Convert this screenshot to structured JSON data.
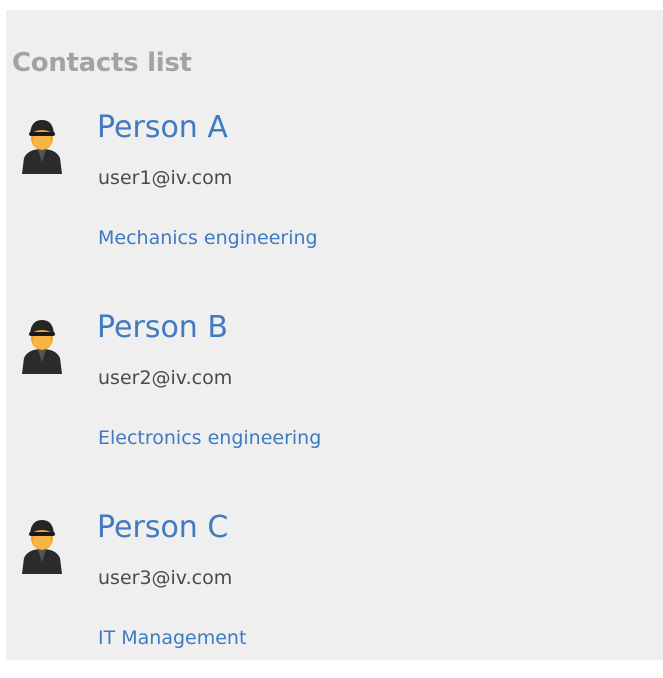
{
  "header": {
    "title": "Contacts list"
  },
  "contacts": [
    {
      "name": "Person A",
      "email": "user1@iv.com",
      "department": "Mechanics engineering",
      "avatar_icon": "user-avatar-icon"
    },
    {
      "name": "Person B",
      "email": "user2@iv.com",
      "department": "Electronics engineering",
      "avatar_icon": "user-avatar-icon"
    },
    {
      "name": "Person C",
      "email": "user3@iv.com",
      "department": "IT Management",
      "avatar_icon": "user-avatar-icon"
    }
  ],
  "colors": {
    "background": "#efefef",
    "title": "#a3a3a3",
    "link": "#3f7ac2",
    "email": "#4a4a4a"
  }
}
